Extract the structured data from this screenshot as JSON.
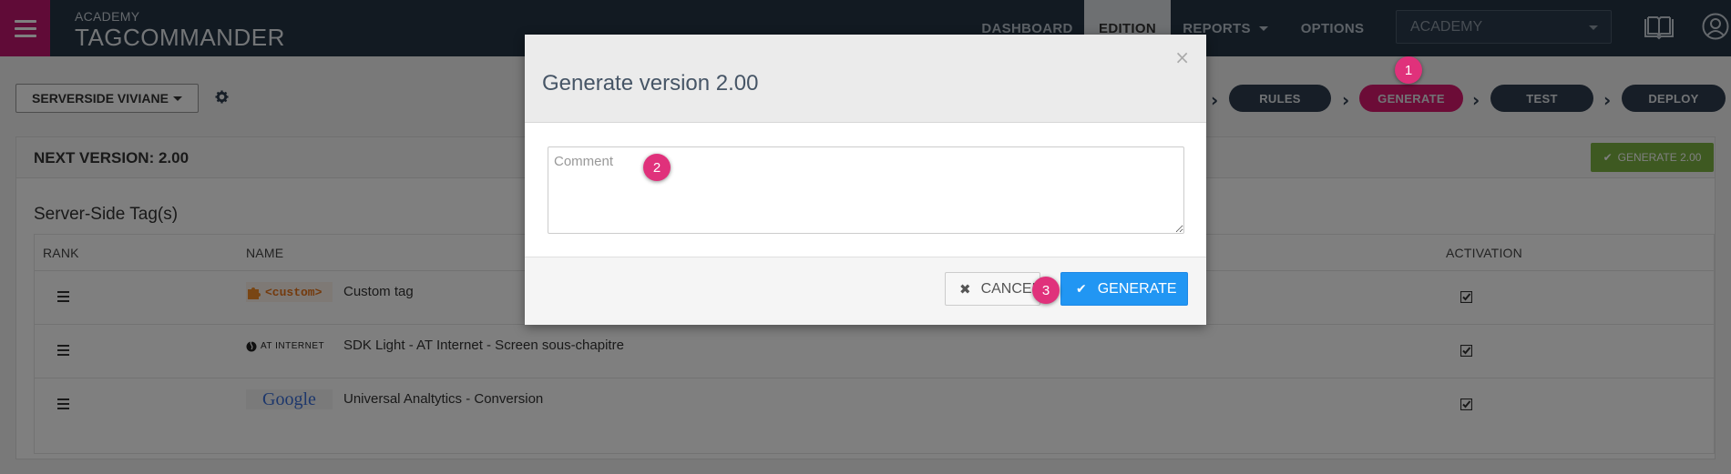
{
  "header": {
    "brand_sub": "ACADEMY",
    "brand": "TAGCOMMANDER",
    "nav": [
      {
        "label": "DASHBOARD",
        "active": false
      },
      {
        "label": "EDITION",
        "active": true
      },
      {
        "label": "REPORTS",
        "active": false
      },
      {
        "label": "OPTIONS",
        "active": false
      }
    ],
    "account_select": "ACADEMY"
  },
  "toolbar": {
    "environment": "SERVERSIDE VIVIANE",
    "steps": [
      "RULES",
      "GENERATE",
      "TEST",
      "DEPLOY"
    ],
    "active_step": "GENERATE"
  },
  "panel": {
    "next_version": "NEXT VERSION: 2.00",
    "generate_button": "GENERATE 2.00",
    "section_title": "Server-Side Tag(s)",
    "columns": [
      "RANK",
      "NAME",
      "ACTIVATION"
    ],
    "rows": [
      {
        "logo": "<custom>",
        "name": "Custom tag",
        "active": true
      },
      {
        "logo": "AT INTERNET",
        "name": "SDK Light - AT Internet - Screen sous-chapitre",
        "active": true
      },
      {
        "logo": "Google",
        "name": "Universal Analtytics - Conversion",
        "active": true
      }
    ]
  },
  "modal": {
    "title": "Generate version 2.00",
    "close": "×",
    "comment_placeholder": "Comment",
    "cancel_label": "CANCEL",
    "generate_label": "GENERATE"
  },
  "badges": [
    "1",
    "2",
    "3"
  ],
  "colors": {
    "accent": "#c0166e",
    "topbar": "#243445",
    "primary_button": "#2196f3",
    "success_button": "#7cb342"
  }
}
